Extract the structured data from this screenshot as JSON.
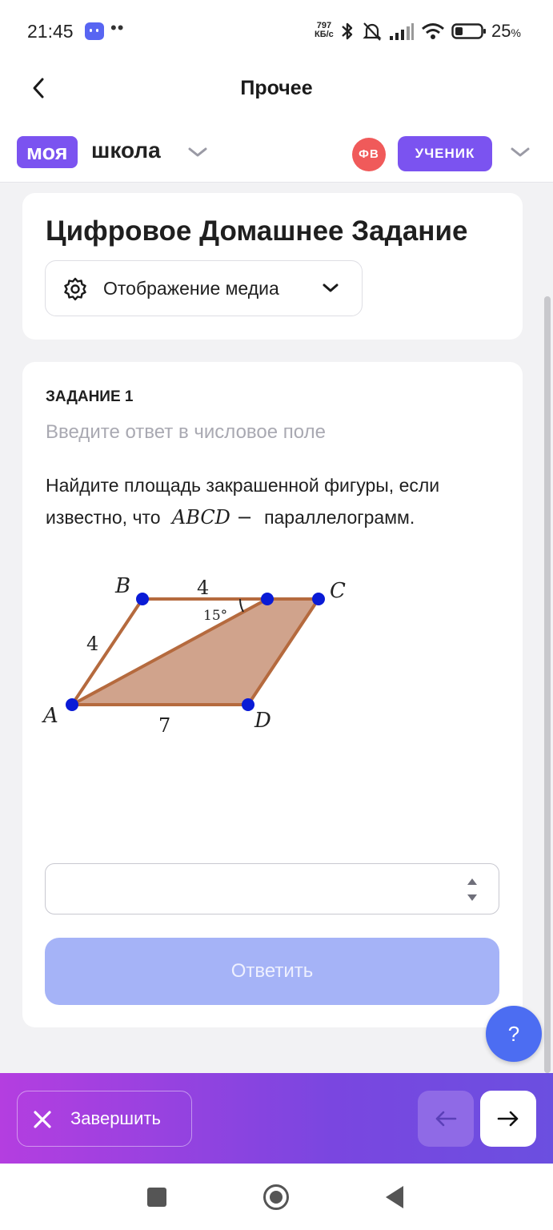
{
  "status_bar": {
    "time": "21:45",
    "dots": "••",
    "net_speed_value": "797",
    "net_speed_unit": "КБ/с",
    "battery_percent": "25",
    "battery_suffix": "%",
    "icons": [
      "discord-icon",
      "bluetooth-icon",
      "bell-off-icon",
      "signal-icon",
      "wifi-icon",
      "battery-icon"
    ]
  },
  "header": {
    "title": "Прочее"
  },
  "brand": {
    "logo_part1": "моя",
    "logo_part2": "школа",
    "user_initials": "ФВ",
    "role": "УЧЕНИК",
    "accent_color": "#7b53f0",
    "avatar_color": "#f05a5a"
  },
  "card_header": {
    "title": "Цифровое Домашнее Задание",
    "media_button_label": "Отображение медиа"
  },
  "task": {
    "label": "ЗАДАНИЕ 1",
    "hint": "Введите ответ в числовое поле",
    "text_before": "Найдите площадь закрашенной фигуры, если известно, что",
    "math": "ABCD −",
    "text_after": "параллелограмм.",
    "figure": {
      "labels": {
        "A": "A",
        "B": "B",
        "C": "C",
        "D": "D"
      },
      "side_AB": "4",
      "side_BE": "4",
      "side_AD": "7",
      "angle": "15°",
      "fill_color": "#d0a38c",
      "edge_color": "#b56a3e",
      "point_color": "#0a1bd6"
    },
    "answer_value": "",
    "submit_label": "Ответить"
  },
  "help_button": "?",
  "action_bar": {
    "finish_label": "Завершить",
    "prev_arrow": "←",
    "next_arrow": "→"
  }
}
